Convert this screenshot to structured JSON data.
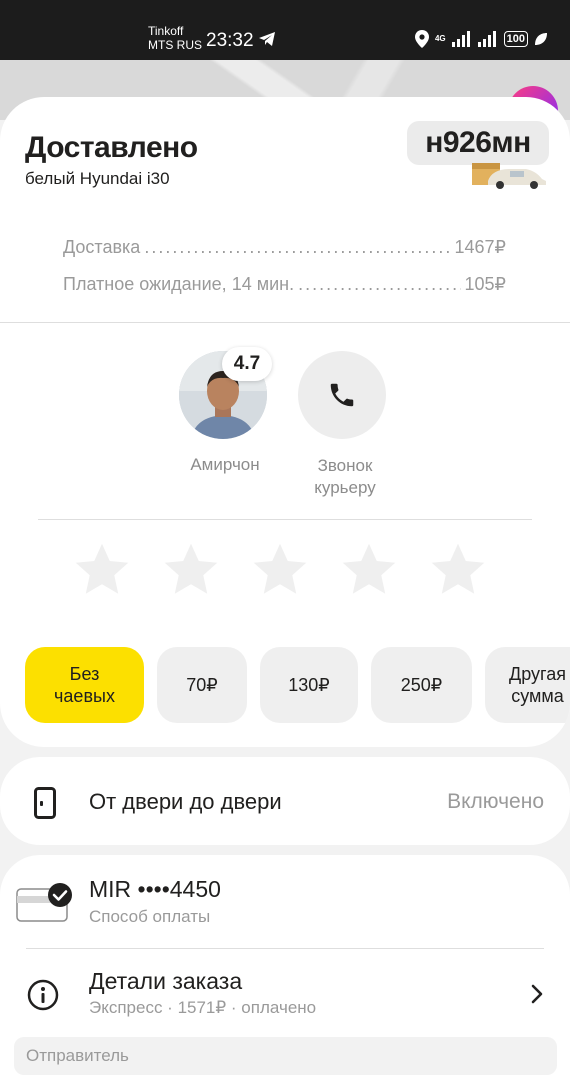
{
  "status_bar": {
    "carrier_line1": "Tinkoff",
    "carrier_line2": "MTS RUS",
    "time": "23:32",
    "network": "4G",
    "battery": "100"
  },
  "order": {
    "status": "Доставлено",
    "car": "белый Hyundai i30",
    "plate": "н926мн"
  },
  "costs": [
    {
      "label": "Доставка",
      "amount": "1467₽"
    },
    {
      "label": "Платное ожидание, 14 мин.",
      "amount": "105₽"
    }
  ],
  "courier": {
    "name": "Амирчон",
    "rating": "4.7",
    "call_label_line1": "Звонок",
    "call_label_line2": "курьеру"
  },
  "rating_stars": 5,
  "tips": {
    "options": [
      {
        "line1": "Без",
        "line2": "чаевых",
        "selected": true
      },
      {
        "line1": "70₽",
        "line2": "",
        "selected": false
      },
      {
        "line1": "130₽",
        "line2": "",
        "selected": false
      },
      {
        "line1": "250₽",
        "line2": "",
        "selected": false
      },
      {
        "line1": "Другая",
        "line2": "сумма",
        "selected": false
      }
    ],
    "accent_color": "#fce000"
  },
  "door_to_door": {
    "label": "От двери до двери",
    "state": "Включено"
  },
  "payment": {
    "method": "MIR ••••4450",
    "subtitle": "Способ оплаты"
  },
  "order_details": {
    "title": "Детали заказа",
    "subtitle": "Экспресс · 1571₽ · оплачено"
  },
  "sender": {
    "label": "Отправитель"
  }
}
